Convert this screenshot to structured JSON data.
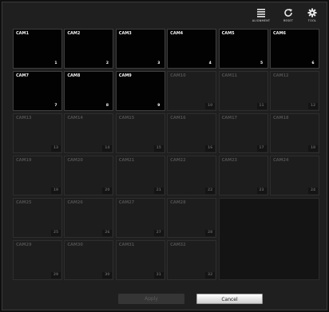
{
  "toolbar": {
    "alignment": {
      "label": "ALIGNMENT",
      "icon": "alignment-icon"
    },
    "reset": {
      "label": "RESET",
      "icon": "reset-icon"
    },
    "tool": {
      "label": "TOOL",
      "icon": "gear-icon"
    }
  },
  "cameras": [
    {
      "name": "CAM1",
      "num": "1",
      "active": true
    },
    {
      "name": "CAM2",
      "num": "2",
      "active": true
    },
    {
      "name": "CAM3",
      "num": "3",
      "active": true
    },
    {
      "name": "CAM4",
      "num": "4",
      "active": true
    },
    {
      "name": "CAM5",
      "num": "5",
      "active": true
    },
    {
      "name": "CAM6",
      "num": "6",
      "active": true
    },
    {
      "name": "CAM7",
      "num": "7",
      "active": true
    },
    {
      "name": "CAM8",
      "num": "8",
      "active": true
    },
    {
      "name": "CAM9",
      "num": "9",
      "active": true
    },
    {
      "name": "CAM10",
      "num": "10",
      "active": false
    },
    {
      "name": "CAM11",
      "num": "11",
      "active": false
    },
    {
      "name": "CAM12",
      "num": "12",
      "active": false
    },
    {
      "name": "CAM13",
      "num": "13",
      "active": false
    },
    {
      "name": "CAM14",
      "num": "14",
      "active": false
    },
    {
      "name": "CAM15",
      "num": "15",
      "active": false
    },
    {
      "name": "CAM16",
      "num": "16",
      "active": false
    },
    {
      "name": "CAM17",
      "num": "17",
      "active": false
    },
    {
      "name": "CAM18",
      "num": "18",
      "active": false
    },
    {
      "name": "CAM19",
      "num": "19",
      "active": false
    },
    {
      "name": "CAM20",
      "num": "20",
      "active": false
    },
    {
      "name": "CAM21",
      "num": "21",
      "active": false
    },
    {
      "name": "CAM22",
      "num": "22",
      "active": false
    },
    {
      "name": "CAM23",
      "num": "23",
      "active": false
    },
    {
      "name": "CAM24",
      "num": "24",
      "active": false
    },
    {
      "name": "CAM25",
      "num": "25",
      "active": false
    },
    {
      "name": "CAM26",
      "num": "26",
      "active": false
    },
    {
      "name": "CAM27",
      "num": "27",
      "active": false
    },
    {
      "name": "CAM28",
      "num": "28",
      "active": false
    },
    {
      "name": "CAM29",
      "num": "29",
      "active": false
    },
    {
      "name": "CAM30",
      "num": "30",
      "active": false
    },
    {
      "name": "CAM31",
      "num": "31",
      "active": false
    },
    {
      "name": "CAM32",
      "num": "32",
      "active": false
    }
  ],
  "buttons": {
    "apply": "Apply",
    "cancel": "Cancel"
  },
  "colors": {
    "active_cell": "#020202",
    "inactive_cell": "#1d1d1d",
    "panel": "#1f1f1f"
  }
}
